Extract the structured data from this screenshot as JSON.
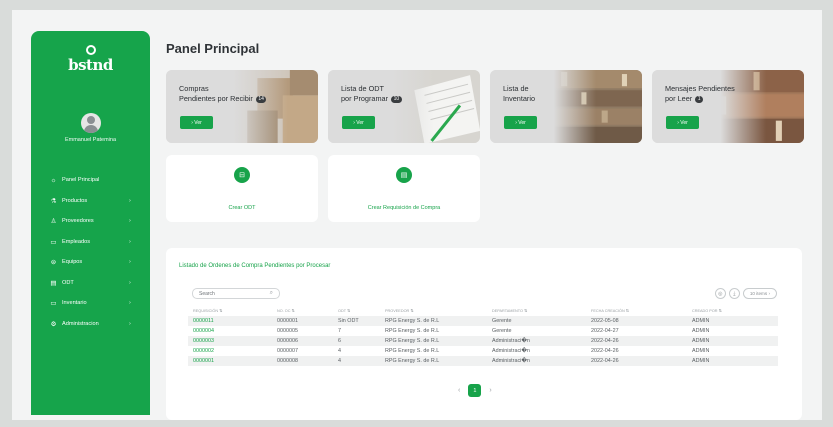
{
  "brand": {
    "name": "bstnd"
  },
  "user": {
    "name": "Emmanuel Patemina"
  },
  "sidebar": {
    "items": [
      {
        "label": "Panel Principal",
        "icon": "dashboard-icon",
        "glyph": "☼"
      },
      {
        "label": "Productos",
        "icon": "products-icon",
        "glyph": "⚗",
        "chevron": "›"
      },
      {
        "label": "Proveedores",
        "icon": "supplier-icon",
        "glyph": "♙",
        "chevron": "›"
      },
      {
        "label": "Empleados",
        "icon": "employees-icon",
        "glyph": "▭",
        "chevron": "›"
      },
      {
        "label": "Equipos",
        "icon": "equipment-icon",
        "glyph": "⊜",
        "chevron": "›"
      },
      {
        "label": "ODT",
        "icon": "odt-icon",
        "glyph": "▤",
        "chevron": "›"
      },
      {
        "label": "Inventario",
        "icon": "inventory-icon",
        "glyph": "▭",
        "chevron": "›"
      },
      {
        "label": "Administracion",
        "icon": "admin-gear-icon",
        "glyph": "⚙",
        "chevron": "›"
      }
    ]
  },
  "page": {
    "title": "Panel Principal"
  },
  "cards": [
    {
      "line1": "Compras",
      "line2": "Pendientes por Recibir",
      "badge": "14",
      "button": "› Ver"
    },
    {
      "line1": "Lista de ODT",
      "line2": "por Programar",
      "badge": "10",
      "button": "› Ver"
    },
    {
      "line1": "Lista de",
      "line2": "Inventario",
      "badge": "",
      "button": "› Ver"
    },
    {
      "line1": "Mensajes Pendientes",
      "line2": "por Leer",
      "badge": "1",
      "button": "› Ver"
    }
  ],
  "actions": [
    {
      "label": "Crear ODT",
      "icon": "create-odt-icon"
    },
    {
      "label": "Crear Requisición de Compra",
      "icon": "create-requisition-icon"
    }
  ],
  "table_panel": {
    "title": "Listado de Ordenes de Compra Pendientes por Procesar",
    "search_placeholder": "Search",
    "items_per_page": "10 items",
    "columns": [
      "REQUISICIÓN ⇅",
      "NO. OC ⇅",
      "ODT ⇅",
      "PROVEEDOR ⇅",
      "DEPARTAMENTO ⇅",
      "FECHA CREACIÓN ⇅",
      "CREADO POR ⇅"
    ],
    "rows": [
      [
        "0000011",
        "0000001",
        "Sin ODT",
        "RPG Energy S. de R.L",
        "Gerente",
        "2022-05-08",
        "ADMIN"
      ],
      [
        "0000004",
        "0000005",
        "7",
        "RPG Energy S. de R.L",
        "Gerente",
        "2022-04-27",
        "ADMIN"
      ],
      [
        "0000003",
        "0000006",
        "6",
        "RPG Energy S. de R.L",
        "Administraci�n",
        "2022-04-26",
        "ADMIN"
      ],
      [
        "0000002",
        "0000007",
        "4",
        "RPG Energy S. de R.L",
        "Administraci�n",
        "2022-04-26",
        "ADMIN"
      ],
      [
        "0000001",
        "0000008",
        "4",
        "RPG Energy S. de R.L",
        "Administraci�n",
        "2022-04-26",
        "ADMIN"
      ]
    ],
    "pagination": {
      "prev": "‹",
      "current": "1",
      "next": "›"
    }
  },
  "colors": {
    "accent": "#16a44b",
    "badge": "#3a3d40",
    "page_bg": "#f3f4f4"
  }
}
